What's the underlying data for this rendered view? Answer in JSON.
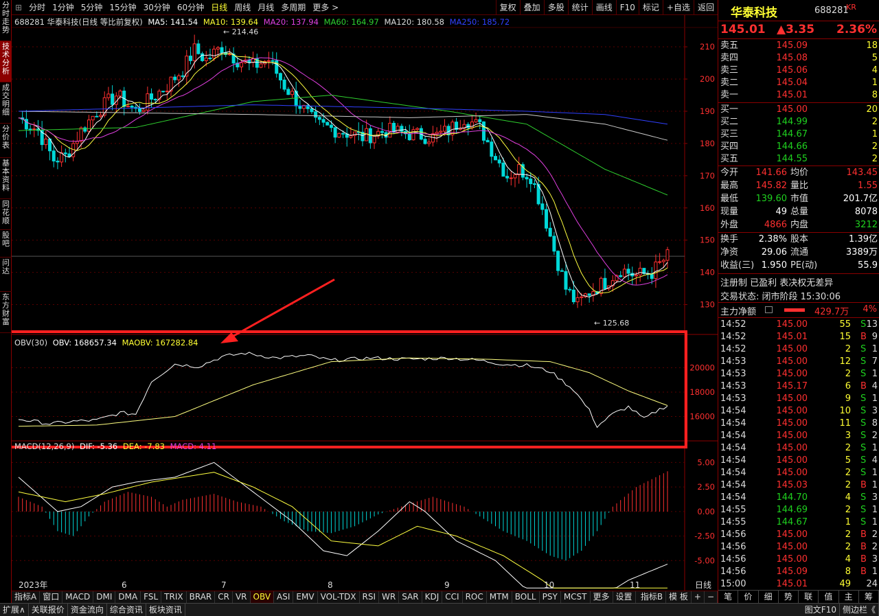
{
  "vertical_tabs": [
    {
      "label": "分时走势",
      "active": false
    },
    {
      "label": "技术分析",
      "active": true
    },
    {
      "label": "成交明细",
      "active": false
    },
    {
      "label": "分价表",
      "active": false
    },
    {
      "label": "基本资料",
      "active": false
    },
    {
      "label": "同花顺",
      "active": false
    },
    {
      "label": "股吧",
      "active": false
    },
    {
      "label": "问达",
      "active": false
    },
    {
      "label": "东方财富",
      "active": false
    }
  ],
  "toolbar": {
    "left": [
      "分时",
      "1分钟",
      "5分钟",
      "15分钟",
      "30分钟",
      "60分钟",
      "日线",
      "周线",
      "月线",
      "多周期",
      "更多 >"
    ],
    "active": "日线",
    "right": [
      "复权",
      "叠加",
      "多股",
      "统计",
      "画线",
      "F10",
      "标记",
      "+自选",
      "返回"
    ]
  },
  "legend": {
    "stock": "688281 华泰科技(日线 等比前复权)",
    "ma5": "MA5: 141.54",
    "ma10": "MA10: 139.64",
    "ma20": "MA20: 137.94",
    "ma60": "MA60: 164.97",
    "ma120": "MA120: 180.58",
    "ma250": "MA250: 185.72"
  },
  "obv_legend": {
    "name": "OBV(30)",
    "obv": "OBV: 168657.34",
    "maobv": "MAOBV: 167282.84"
  },
  "macd_legend": {
    "name": "MACD(12,26,9)",
    "dif": "DIF: -5.36",
    "dea": "DEA: -7.83",
    "macd": "MACD: 4.11"
  },
  "annotations": {
    "high": "214.46",
    "low": "125.68"
  },
  "indicator_tabs": [
    "指标A",
    "窗口",
    "MACD",
    "DMI",
    "DMA",
    "FSL",
    "TRIX",
    "BRAR",
    "CR",
    "VR",
    "OBV",
    "ASI",
    "EMV",
    "VOL-TDX",
    "RSI",
    "WR",
    "SAR",
    "KDJ",
    "CCI",
    "ROC",
    "MTM",
    "BOLL",
    "PSY",
    "MCST",
    "更多",
    "设置"
  ],
  "indicator_tabs_right": [
    "指标B",
    "模 板"
  ],
  "active_indicator": "OBV",
  "bottom_bar": [
    "扩展∧",
    "关联报价",
    "资金流向",
    "综合资讯",
    "板块资讯"
  ],
  "bottom_bar_right": [
    "图文F10",
    "侧边栏《"
  ],
  "chart_data": {
    "type": "candlestick",
    "price_axis": [
      210.0,
      200.0,
      190.0,
      180.0,
      170.0,
      160.0,
      150.0,
      140.0,
      130.0
    ],
    "obv_axis": [
      20000,
      18000,
      16000
    ],
    "macd_axis": [
      "5.00",
      "2.50",
      "0.00",
      "-2.50",
      "-5.00"
    ],
    "x_labels": [
      "2023年",
      "6",
      "7",
      "8",
      "9",
      "10",
      "11",
      "日线"
    ],
    "ylim": [
      125,
      214
    ]
  },
  "quote": {
    "name": "华泰科技",
    "code": "688281",
    "tag": "KR",
    "price": "145.01",
    "change": "▲3.35",
    "pct": "2.36%"
  },
  "orderbook": {
    "asks": [
      {
        "label": "卖五",
        "price": "145.09",
        "vol": "18"
      },
      {
        "label": "卖四",
        "price": "145.08",
        "vol": "5"
      },
      {
        "label": "卖三",
        "price": "145.06",
        "vol": "4"
      },
      {
        "label": "卖二",
        "price": "145.04",
        "vol": "1"
      },
      {
        "label": "卖一",
        "price": "145.01",
        "vol": "8"
      }
    ],
    "bids": [
      {
        "label": "买一",
        "price": "145.00",
        "vol": "20"
      },
      {
        "label": "买二",
        "price": "144.99",
        "vol": "2"
      },
      {
        "label": "买三",
        "price": "144.67",
        "vol": "1"
      },
      {
        "label": "买四",
        "price": "144.66",
        "vol": "2"
      },
      {
        "label": "买五",
        "price": "144.55",
        "vol": "2"
      }
    ]
  },
  "stats": [
    {
      "l1": "今开",
      "v1": "141.66",
      "c1": "red",
      "l2": "均价",
      "v2": "143.45",
      "c2": "red"
    },
    {
      "l1": "最高",
      "v1": "145.82",
      "c1": "red",
      "l2": "量比",
      "v2": "1.55",
      "c2": "red"
    },
    {
      "l1": "最低",
      "v1": "139.60",
      "c1": "green",
      "l2": "市值",
      "v2": "201.7亿",
      "c2": "white"
    },
    {
      "l1": "现量",
      "v1": "49",
      "c1": "white",
      "l2": "总量",
      "v2": "8078",
      "c2": "white"
    },
    {
      "l1": "外盘",
      "v1": "4866",
      "c1": "red",
      "l2": "内盘",
      "v2": "3212",
      "c2": "green"
    },
    {
      "l1": "换手",
      "v1": "2.38%",
      "c1": "white",
      "l2": "股本",
      "v2": "1.39亿",
      "c2": "white"
    },
    {
      "l1": "净资",
      "v1": "29.06",
      "c1": "white",
      "l2": "流通",
      "v2": "3389万",
      "c2": "white"
    },
    {
      "l1": "收益(三)",
      "v1": "1.950",
      "c1": "white",
      "l2": "PE(动)",
      "v2": "55.9",
      "c2": "white"
    }
  ],
  "info": {
    "reg": "注册制 已盈利 表决权无差异",
    "status": "交易状态: 闭市阶段 15:30:06",
    "flow_label": "主力净额",
    "flow_value": "429.7万",
    "flow_pct": "4%"
  },
  "ticks": [
    {
      "t": "14:52",
      "p": "145.00",
      "v": "55",
      "d": "S",
      "n": "13"
    },
    {
      "t": "14:52",
      "p": "145.01",
      "v": "15",
      "d": "B",
      "n": "9"
    },
    {
      "t": "14:52",
      "p": "145.00",
      "v": "2",
      "d": "S",
      "n": "1"
    },
    {
      "t": "14:53",
      "p": "145.00",
      "v": "12",
      "d": "S",
      "n": "7"
    },
    {
      "t": "14:53",
      "p": "145.00",
      "v": "2",
      "d": "S",
      "n": "1"
    },
    {
      "t": "14:53",
      "p": "145.17",
      "v": "6",
      "d": "B",
      "n": "4"
    },
    {
      "t": "14:53",
      "p": "145.00",
      "v": "9",
      "d": "S",
      "n": "1"
    },
    {
      "t": "14:54",
      "p": "145.00",
      "v": "10",
      "d": "S",
      "n": "3"
    },
    {
      "t": "14:54",
      "p": "145.00",
      "v": "11",
      "d": "S",
      "n": "8"
    },
    {
      "t": "14:54",
      "p": "145.00",
      "v": "3",
      "d": "S",
      "n": "2"
    },
    {
      "t": "14:54",
      "p": "145.00",
      "v": "2",
      "d": "S",
      "n": "1"
    },
    {
      "t": "14:54",
      "p": "145.00",
      "v": "5",
      "d": "S",
      "n": "4"
    },
    {
      "t": "14:54",
      "p": "145.00",
      "v": "2",
      "d": "S",
      "n": "1"
    },
    {
      "t": "14:54",
      "p": "145.03",
      "v": "2",
      "d": "B",
      "n": "1"
    },
    {
      "t": "14:54",
      "p": "144.70",
      "v": "4",
      "d": "S",
      "n": "3"
    },
    {
      "t": "14:55",
      "p": "144.69",
      "v": "2",
      "d": "S",
      "n": "1"
    },
    {
      "t": "14:55",
      "p": "144.67",
      "v": "1",
      "d": "S",
      "n": "1"
    },
    {
      "t": "14:56",
      "p": "145.00",
      "v": "2",
      "d": "B",
      "n": "2"
    },
    {
      "t": "14:56",
      "p": "145.00",
      "v": "2",
      "d": "B",
      "n": "2"
    },
    {
      "t": "14:56",
      "p": "145.00",
      "v": "4",
      "d": "B",
      "n": "3"
    },
    {
      "t": "14:56",
      "p": "145.09",
      "v": "8",
      "d": "B",
      "n": "1"
    },
    {
      "t": "15:00",
      "p": "145.01",
      "v": "49",
      "d": "",
      "n": "24"
    }
  ],
  "right_tabs": [
    "笔",
    "价",
    "细",
    "势",
    "联",
    "值",
    "主",
    "筹"
  ]
}
